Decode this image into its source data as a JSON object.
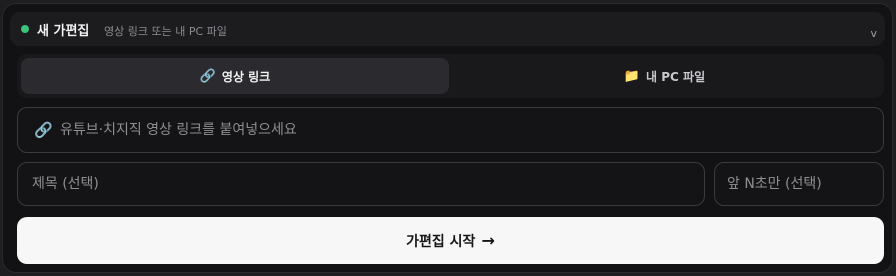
{
  "header": {
    "title": "새 가편집",
    "subtitle": "영상 링크 또는 내 PC 파일",
    "collapse_glyph": "v",
    "status_dot_color": "#3ec27a",
    "collapse_icon": "chevron-down-icon"
  },
  "tabs": [
    {
      "label": "영상 링크",
      "icon": "link-icon",
      "active": true
    },
    {
      "label": "내 PC 파일",
      "icon": "folder-icon",
      "active": false
    }
  ],
  "link_input": {
    "placeholder": "유튜브·치지직 영상 링크를 붙여넣으세요",
    "value": "",
    "icon": "link-icon"
  },
  "title_input": {
    "placeholder": "제목 (선택)",
    "value": ""
  },
  "duration_input": {
    "placeholder": "앞 N초만 (선택)",
    "value": ""
  },
  "start_button": {
    "label": "가편집 시작",
    "arrow": "→"
  }
}
